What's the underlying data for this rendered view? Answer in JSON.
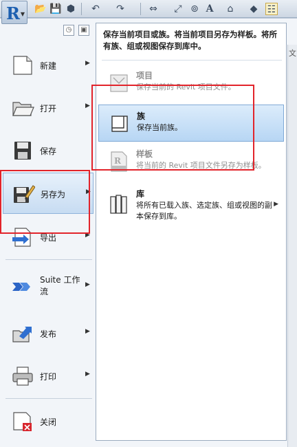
{
  "toolbar": {
    "app_letter": "R",
    "edge_char": "文"
  },
  "menu": {
    "commands": [
      {
        "key": "new",
        "label": "新建",
        "has_arrow": true
      },
      {
        "key": "open",
        "label": "打开",
        "has_arrow": true
      },
      {
        "key": "save",
        "label": "保存",
        "has_arrow": false
      },
      {
        "key": "save-as",
        "label": "另存为",
        "has_arrow": true,
        "highlighted": true
      },
      {
        "key": "export",
        "label": "导出",
        "has_arrow": true
      },
      {
        "key": "suite",
        "label": "Suite 工作流",
        "has_arrow": true
      },
      {
        "key": "publish",
        "label": "发布",
        "has_arrow": true
      },
      {
        "key": "print",
        "label": "打印",
        "has_arrow": true
      },
      {
        "key": "close",
        "label": "关闭",
        "has_arrow": false
      }
    ]
  },
  "submenu": {
    "header": "保存当前项目或族。将当前项目另存为样板。将所有族、组或视图保存到库中。",
    "items": [
      {
        "key": "project",
        "title": "项目",
        "desc": "保存当前的 Revit 项目文件。",
        "disabled": true
      },
      {
        "key": "family",
        "title": "族",
        "desc": "保存当前族。",
        "selected": true
      },
      {
        "key": "template",
        "title": "样板",
        "desc": "将当前的 Revit 项目文件另存为样板。",
        "disabled": true
      },
      {
        "key": "library",
        "title": "库",
        "desc": "将所有已载入族、选定族、组或视图的副本保存到库。",
        "has_arrow": true
      }
    ]
  },
  "arrow_glyph": "▶",
  "colors": {
    "highlight": "#c7dcf2",
    "annotation_red": "#e2232a"
  }
}
